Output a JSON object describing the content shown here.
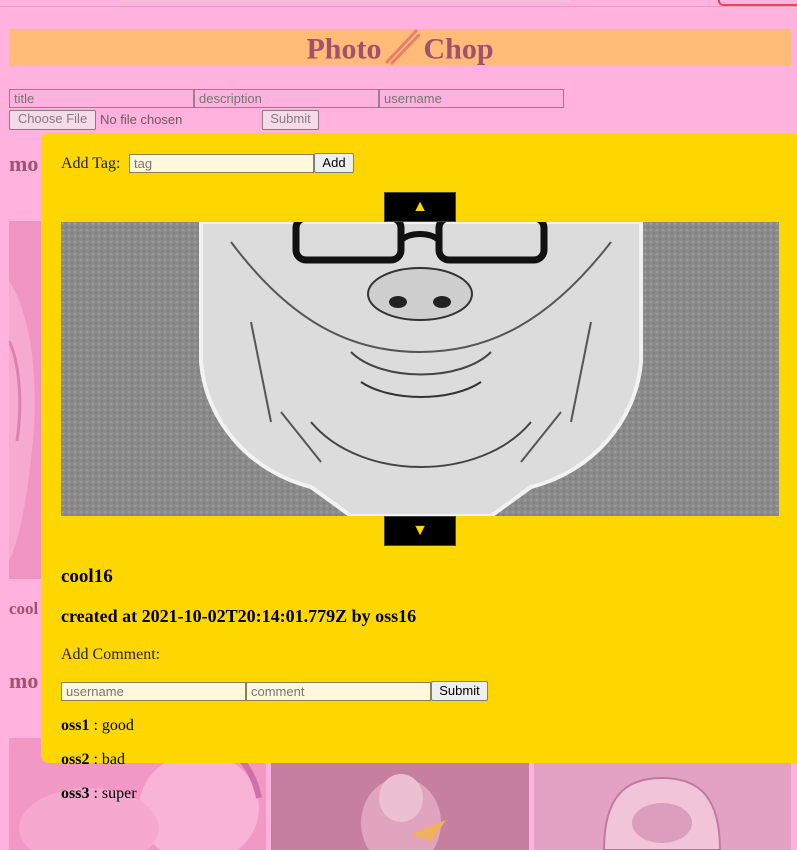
{
  "app": {
    "title_left": "Photo",
    "title_right": "Chop",
    "logo_icon": "chopsticks-icon"
  },
  "upload": {
    "title_placeholder": "title",
    "description_placeholder": "description",
    "username_placeholder": "username",
    "choose_file_label": "Choose File",
    "no_file_text": "No file chosen",
    "submit_label": "Submit"
  },
  "background": {
    "heading1": "mo",
    "heading2": "mo",
    "caption1": "cool"
  },
  "modal": {
    "add_tag_label": "Add Tag:",
    "tag_placeholder": "tag",
    "add_button": "Add",
    "up_arrow": "▲",
    "down_arrow": "▼",
    "photo_title": "cool16",
    "created_text": "created at 2021-10-02T20:14:01.779Z by oss16",
    "add_comment_label": "Add Comment:",
    "comment_username_placeholder": "username",
    "comment_placeholder": "comment",
    "comment_submit": "Submit",
    "comments": [
      {
        "user": "oss1",
        "text": " : good"
      },
      {
        "user": "oss2",
        "text": " : bad"
      },
      {
        "user": "oss3",
        "text": " : super"
      }
    ]
  },
  "colors": {
    "page_bg": "#ffb2dd",
    "banner_bg": "#ffbb77",
    "modal_bg": "#ffd700",
    "brand_text": "#a0526e"
  }
}
